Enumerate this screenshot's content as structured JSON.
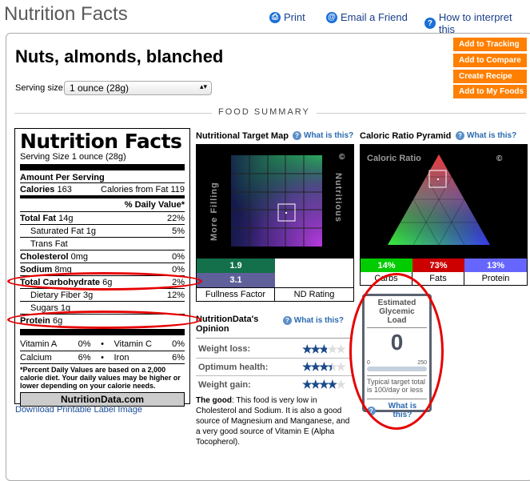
{
  "header": {
    "title": "Nutrition Facts",
    "links": [
      {
        "icon": "print-icon",
        "label": "Print"
      },
      {
        "icon": "at-icon",
        "label": "Email a Friend"
      },
      {
        "icon": "help-icon",
        "label": "How to interpret this"
      }
    ]
  },
  "food": {
    "name": "Nuts, almonds, blanched",
    "serving_label": "Serving size:",
    "serving_value": "1 ounce (28g)"
  },
  "actions": [
    "Add to Tracking",
    "Add to Compare",
    "Create Recipe",
    "Add to My Foods"
  ],
  "summary_title": "FOOD SUMMARY",
  "label": {
    "title": "Nutrition Facts",
    "serving_size": "Serving Size  1 ounce (28g)",
    "amount_per": "Amount Per Serving",
    "calories": "Calories",
    "calories_value": "163",
    "cal_fat": "Calories from Fat 119",
    "dv_header": "% Daily Value*",
    "rows": [
      {
        "name": "Total Fat",
        "amt": "14g",
        "dv": "22%",
        "bold": true
      },
      {
        "name": "Saturated Fat",
        "amt": "1g",
        "dv": "5%",
        "bold": false
      },
      {
        "name": "Trans Fat",
        "amt": "",
        "dv": "",
        "bold": false
      },
      {
        "name": "Cholesterol",
        "amt": "0mg",
        "dv": "0%",
        "bold": true
      },
      {
        "name": "Sodium",
        "amt": "8mg",
        "dv": "0%",
        "bold": true
      },
      {
        "name": "Total Carbohydrate",
        "amt": "6g",
        "dv": "2%",
        "bold": true
      },
      {
        "name": "Dietary Fiber",
        "amt": "3g",
        "dv": "12%",
        "bold": false
      },
      {
        "name": "Sugars",
        "amt": "1g",
        "dv": "",
        "bold": false
      },
      {
        "name": "Protein",
        "amt": "6g",
        "dv": "",
        "bold": true
      }
    ],
    "vitamins": [
      {
        "a": "Vitamin A",
        "av": "0%",
        "b": "Vitamin C",
        "bv": "0%"
      },
      {
        "a": "Calcium",
        "av": "6%",
        "b": "Iron",
        "bv": "6%"
      }
    ],
    "footnote": "*Percent Daily Values are based on a 2,000 calorie diet. Your daily values may be higher or lower depending on your calorie needs.",
    "brand": "NutritionData.com"
  },
  "download_link": "Download Printable Label Image",
  "target_map": {
    "title": "Nutritional Target Map",
    "what": "What is this?",
    "y_axis": "More Filling",
    "x_axis": "Nutritious",
    "fullness_value": "1.9",
    "nd_value": "3.1",
    "fullness_label": "Fullness Factor",
    "nd_label": "ND Rating"
  },
  "pyramid": {
    "title": "Caloric Ratio Pyramid",
    "what": "What is this?",
    "inner_title": "Caloric Ratio",
    "carbs": "14%",
    "fats": "73%",
    "protein": "13%",
    "carbs_label": "Carbs",
    "fats_label": "Fats",
    "protein_label": "Protein",
    "colors": {
      "carbs": "#00cc00",
      "fats": "#cc0000",
      "protein": "#6666ff"
    }
  },
  "opinion": {
    "title": "NutritionData's Opinion",
    "what": "What is this?",
    "ratings": [
      {
        "label": "Weight loss:",
        "stars": 2.5
      },
      {
        "label": "Optimum health:",
        "stars": 3
      },
      {
        "label": "Weight gain:",
        "stars": 3.5
      }
    ],
    "good_label": "The good",
    "good_text": ": This food is very low in Cholesterol and Sodium. It is also a good source of Magnesium and Manganese, and a very good source of Vitamin E (Alpha Tocopherol)."
  },
  "glycemic": {
    "title": "Estimated Glycemic Load",
    "value": "0",
    "min": "0",
    "max": "250",
    "note": "Typical target total is 100/day or less",
    "what": "What is this?"
  }
}
